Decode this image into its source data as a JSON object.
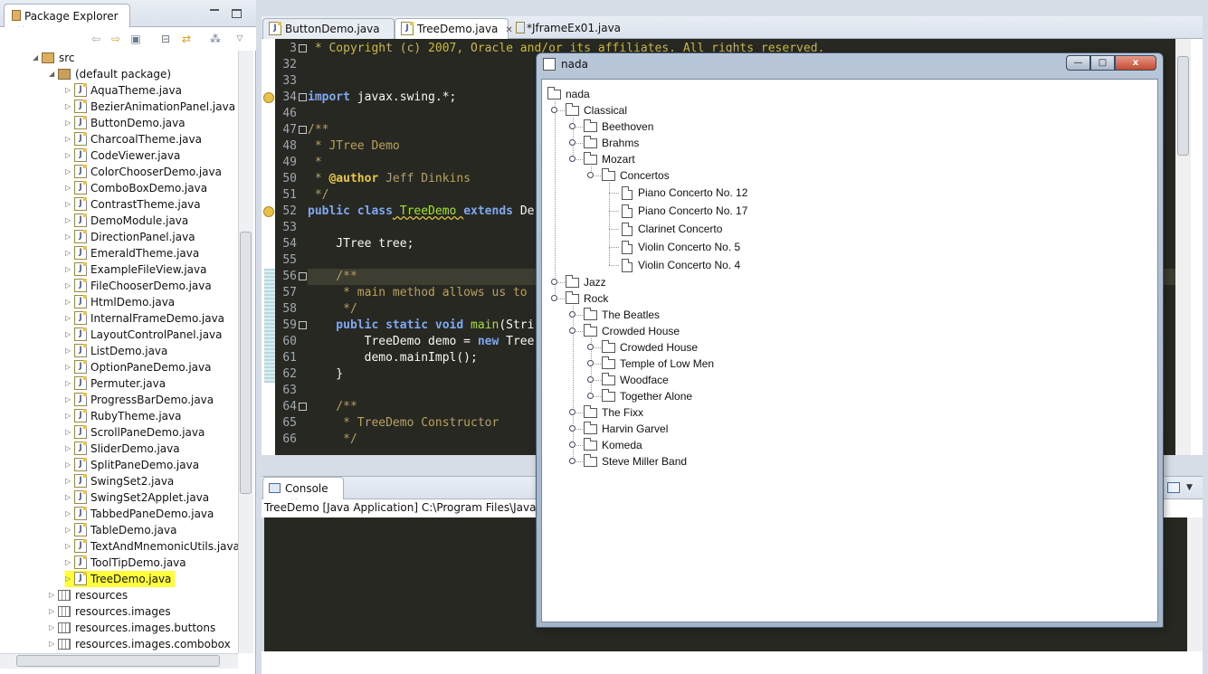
{
  "package_explorer": {
    "title": "Package Explorer",
    "src": "src",
    "default_package": "(default package)",
    "files": [
      "AquaTheme.java",
      "BezierAnimationPanel.java",
      "ButtonDemo.java",
      "CharcoalTheme.java",
      "CodeViewer.java",
      "ColorChooserDemo.java",
      "ComboBoxDemo.java",
      "ContrastTheme.java",
      "DemoModule.java",
      "DirectionPanel.java",
      "EmeraldTheme.java",
      "ExampleFileView.java",
      "FileChooserDemo.java",
      "HtmlDemo.java",
      "InternalFrameDemo.java",
      "LayoutControlPanel.java",
      "ListDemo.java",
      "OptionPaneDemo.java",
      "Permuter.java",
      "ProgressBarDemo.java",
      "RubyTheme.java",
      "ScrollPaneDemo.java",
      "SliderDemo.java",
      "SplitPaneDemo.java",
      "SwingSet2.java",
      "SwingSet2Applet.java",
      "TabbedPaneDemo.java",
      "TableDemo.java",
      "TextAndMnemonicUtils.java",
      "ToolTipDemo.java",
      "TreeDemo.java"
    ],
    "resources": [
      "resources",
      "resources.images",
      "resources.images.buttons",
      "resources.images.combobox"
    ]
  },
  "editor": {
    "tabs": [
      "ButtonDemo.java",
      "TreeDemo.java",
      "*JframeEx01.java"
    ],
    "line_numbers": [
      "3",
      "32",
      "33",
      "34",
      "46",
      "47",
      "48",
      "49",
      "50",
      "51",
      "52",
      "53",
      "54",
      "55",
      "56",
      "57",
      "58",
      "59",
      "60",
      "61",
      "62",
      "63",
      "64",
      "65",
      "66"
    ],
    "lines": {
      "l3": " * Copyright (c) 2007, Oracle and/or its affiliates. All rights reserved.",
      "l34a": "import",
      "l34b": " javax.swing.*;",
      "l47": "/**",
      "l48": " * JTree Demo",
      "l49": " *",
      "l50a": " * ",
      "l50b": "@author",
      "l50c": " Jeff Dinkins",
      "l51": " */",
      "l52a": "public class",
      "l52b": " TreeDemo ",
      "l52c": "extends",
      "l52d": " De",
      "l54": "    JTree tree;",
      "l56": "    /**",
      "l57": "     * main method allows us to",
      "l58": "     */",
      "l59a": "    public static void",
      "l59b": " main",
      "l59c": "(Stri",
      "l60a": "        TreeDemo demo = ",
      "l60b": "new",
      "l60c": " Tree",
      "l61": "        demo.mainImpl();",
      "l62": "    }",
      "l64": "    /**",
      "l65": "     * TreeDemo Constructor",
      "l66": "     */"
    }
  },
  "console": {
    "title": "Console",
    "info": "TreeDemo [Java Application] C:\\Program Files\\Java\\jr"
  },
  "swing_window": {
    "title": "nada",
    "minimize": "—",
    "maximize": "□",
    "close": "x",
    "tree": {
      "root": "nada",
      "classical": "Classical",
      "beethoven": "Beethoven",
      "brahms": "Brahms",
      "mozart": "Mozart",
      "concertos": "Concertos",
      "leaves": [
        "Piano Concerto No. 12",
        "Piano Concerto No. 17",
        "Clarinet Concerto",
        "Violin Concerto No. 5",
        "Violin Concerto No. 4"
      ],
      "jazz": "Jazz",
      "rock": "Rock",
      "beatles": "The Beatles",
      "crowded_house": "Crowded House",
      "ch_children": [
        "Crowded House",
        "Temple of Low Men",
        "Woodface",
        "Together Alone"
      ],
      "rest": [
        "The Fixx",
        "Harvin Garvel",
        "Komeda",
        "Steve Miller Band"
      ]
    }
  },
  "colors": {
    "editor_bg": "#272822",
    "highlight": "#ffff3a",
    "window_frame": "#a5b5ca"
  }
}
